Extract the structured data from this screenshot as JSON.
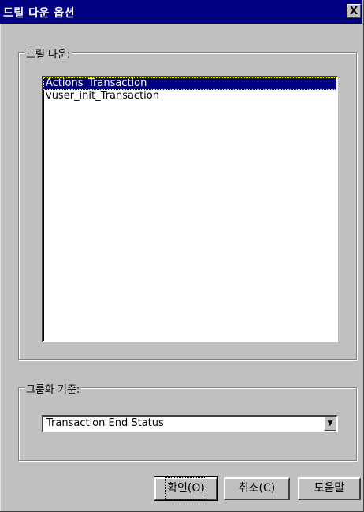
{
  "window": {
    "title": "드릴 다운 옵션",
    "close_label": "X"
  },
  "drill_group": {
    "label": "드릴 다운:",
    "items": [
      {
        "label": "Actions_Transaction",
        "selected": true
      },
      {
        "label": "vuser_init_Transaction",
        "selected": false
      }
    ]
  },
  "group_by": {
    "label": "그룹화 기준:",
    "selected_value": "Transaction End Status",
    "arrow_icon": "chevron-down-icon"
  },
  "buttons": {
    "ok": "확인(O)",
    "cancel": "취소(C)",
    "help": "도움말"
  }
}
